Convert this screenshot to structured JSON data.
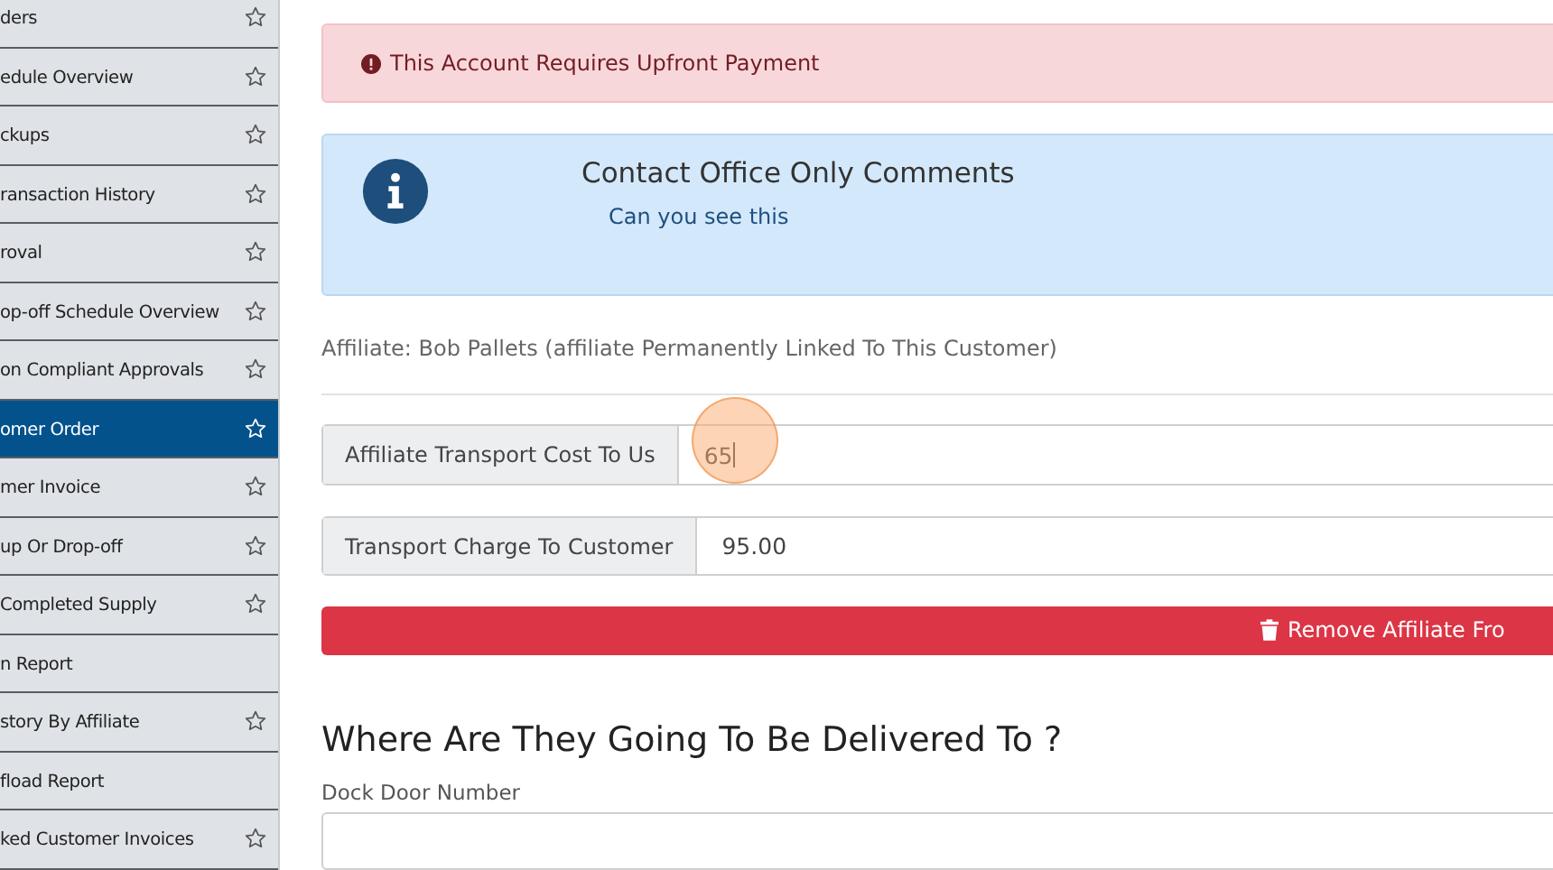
{
  "sidebar": {
    "items": [
      {
        "label": "ders",
        "star": true,
        "selected": false
      },
      {
        "label": "edule Overview",
        "star": true,
        "selected": false
      },
      {
        "label": "ckups",
        "star": true,
        "selected": false
      },
      {
        "label": "ransaction History",
        "star": true,
        "selected": false
      },
      {
        "label": "roval",
        "star": true,
        "selected": false
      },
      {
        "label": "op-off Schedule Overview",
        "star": true,
        "selected": false
      },
      {
        "label": "on Compliant Approvals",
        "star": true,
        "selected": false
      },
      {
        "label": "omer Order",
        "star": true,
        "selected": true
      },
      {
        "label": "mer Invoice",
        "star": true,
        "selected": false
      },
      {
        "label": "up Or Drop-off",
        "star": true,
        "selected": false
      },
      {
        "label": "Completed Supply",
        "star": true,
        "selected": false
      },
      {
        "label": "n Report",
        "star": false,
        "selected": false
      },
      {
        "label": "story By Affiliate",
        "star": true,
        "selected": false
      },
      {
        "label": "fload Report",
        "star": false,
        "selected": false
      },
      {
        "label": "ked Customer Invoices",
        "star": true,
        "selected": false
      }
    ]
  },
  "alert": {
    "text": "This Account Requires Upfront Payment"
  },
  "info": {
    "title": "Contact Office Only Comments",
    "text": "Can you see this"
  },
  "affiliate_note": "Affiliate: Bob Pallets (affiliate Permanently Linked To This Customer)",
  "fields": [
    {
      "label": "Affiliate Transport Cost To Us",
      "value": "65"
    },
    {
      "label": "Transport Charge To Customer",
      "value": "95.00"
    }
  ],
  "remove_button": "Remove Affiliate Fro",
  "delivery": {
    "heading": "Where Are They Going To Be Delivered To ?",
    "field_label": "Dock Door Number"
  }
}
